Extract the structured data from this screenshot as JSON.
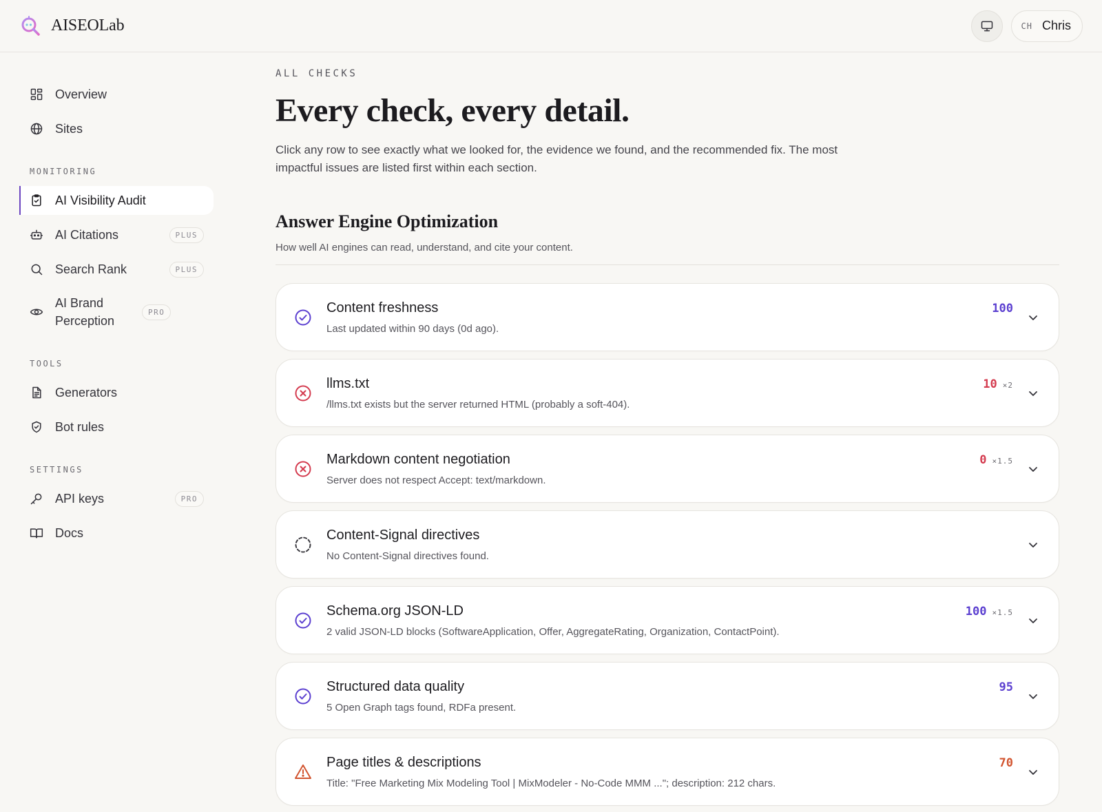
{
  "header": {
    "brand_name": "AISEOLab",
    "user_initials": "CH",
    "user_name": "Chris"
  },
  "sidebar": {
    "top_items": [
      {
        "label": "Overview",
        "icon": "grid-icon"
      },
      {
        "label": "Sites",
        "icon": "globe-icon"
      }
    ],
    "sections": [
      {
        "label": "MONITORING",
        "items": [
          {
            "label": "AI Visibility Audit",
            "icon": "clipboard-icon",
            "active": true,
            "badge": ""
          },
          {
            "label": "AI Citations",
            "icon": "robot-icon",
            "badge": "PLUS"
          },
          {
            "label": "Search Rank",
            "icon": "search-icon",
            "badge": "PLUS"
          },
          {
            "label": "AI Brand Perception",
            "icon": "eye-icon",
            "badge": "PRO"
          }
        ]
      },
      {
        "label": "TOOLS",
        "items": [
          {
            "label": "Generators",
            "icon": "document-icon",
            "badge": ""
          },
          {
            "label": "Bot rules",
            "icon": "shield-icon",
            "badge": ""
          }
        ]
      },
      {
        "label": "SETTINGS",
        "items": [
          {
            "label": "API keys",
            "icon": "key-icon",
            "badge": "PRO"
          },
          {
            "label": "Docs",
            "icon": "book-icon",
            "badge": ""
          }
        ]
      }
    ]
  },
  "main": {
    "eyebrow": "ALL CHECKS",
    "title": "Every check, every detail.",
    "description": "Click any row to see exactly what we looked for, the evidence we found, and the recommended fix. The most impactful issues are listed first within each section.",
    "section": {
      "title": "Answer Engine Optimization",
      "description": "How well AI engines can read, understand, and cite your content."
    },
    "checks": [
      {
        "title": "Content freshness",
        "detail": "Last updated within 90 days (0d ago).",
        "status": "pass",
        "score": "100",
        "multiplier": ""
      },
      {
        "title": "llms.txt",
        "detail": "/llms.txt exists but the server returned HTML (probably a soft-404).",
        "status": "fail",
        "score": "10",
        "multiplier": "×2"
      },
      {
        "title": "Markdown content negotiation",
        "detail": "Server does not respect Accept: text/markdown.",
        "status": "fail",
        "score": "0",
        "multiplier": "×1.5"
      },
      {
        "title": "Content-Signal directives",
        "detail": "No Content-Signal directives found.",
        "status": "neutral",
        "score": "",
        "multiplier": ""
      },
      {
        "title": "Schema.org JSON-LD",
        "detail": "2 valid JSON-LD blocks (SoftwareApplication, Offer, AggregateRating, Organization, ContactPoint).",
        "status": "pass",
        "score": "100",
        "multiplier": "×1.5"
      },
      {
        "title": "Structured data quality",
        "detail": "5 Open Graph tags found, RDFa present.",
        "status": "pass",
        "score": "95",
        "multiplier": ""
      },
      {
        "title": "Page titles & descriptions",
        "detail": "Title: \"Free Marketing Mix Modeling Tool | MixModeler - No-Code MMM ...\"; description: 212 chars.",
        "status": "warn",
        "score": "70",
        "multiplier": ""
      }
    ]
  },
  "colors": {
    "accent": "#6b46c1",
    "pass": "#5b3fd0",
    "fail": "#d43b4f",
    "warn": "#d2542f",
    "neutral": "#3a393f"
  }
}
